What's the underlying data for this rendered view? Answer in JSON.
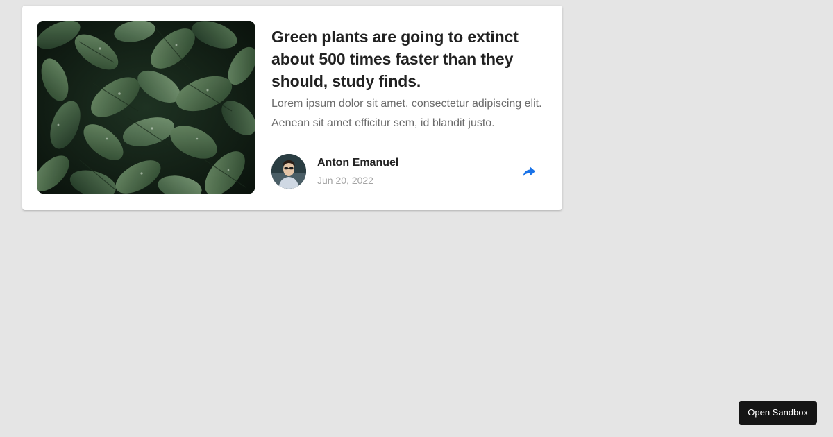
{
  "article": {
    "title": "Green plants are going to extinct about 500 times faster than they should, study finds.",
    "description": "Lorem ipsum dolor sit amet, consectetur adipiscing elit. Aenean sit amet efficitur sem, id blandit justo.",
    "image": "leaves-photo",
    "author": {
      "name": "Anton Emanuel",
      "date": "Jun 20, 2022",
      "avatar": "person-photo"
    },
    "share_icon": "share-arrow-icon"
  },
  "sandbox": {
    "label": "Open Sandbox"
  },
  "colors": {
    "background": "#e5e5e5",
    "card": "#ffffff",
    "title": "#212121",
    "description": "#6b6b6b",
    "date": "#a3a3a3",
    "share": "#1a73e8",
    "sandbox_button": "#151515"
  }
}
